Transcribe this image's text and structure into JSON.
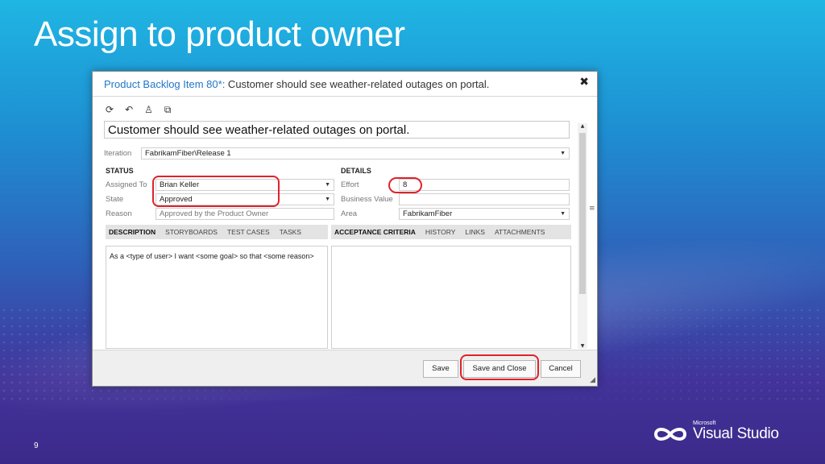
{
  "slide": {
    "title": "Assign to product owner",
    "page_number": "9",
    "logo": {
      "microsoft": "Microsoft",
      "product": "Visual Studio"
    }
  },
  "dialog": {
    "title_link": "Product Backlog Item 80*:",
    "title_text": " Customer should see weather-related outages on portal.",
    "close": "✖",
    "toolbar_icons": [
      "refresh-icon",
      "undo-icon",
      "assign-person-icon",
      "copy-icon"
    ],
    "title_value": "Customer should see weather-related outages on portal.",
    "iteration": {
      "label": "Iteration",
      "value": "FabrikamFiber\\Release 1"
    },
    "status": {
      "heading": "STATUS",
      "assigned_to": {
        "label": "Assigned To",
        "value": "Brian Keller"
      },
      "state": {
        "label": "State",
        "value": "Approved"
      },
      "reason": {
        "label": "Reason",
        "value": "Approved by the Product Owner"
      }
    },
    "details": {
      "heading": "DETAILS",
      "effort": {
        "label": "Effort",
        "value": "8"
      },
      "business_value": {
        "label": "Business Value",
        "value": ""
      },
      "area": {
        "label": "Area",
        "value": "FabrikamFiber"
      }
    },
    "left_tabs": [
      "DESCRIPTION",
      "STORYBOARDS",
      "TEST CASES",
      "TASKS"
    ],
    "right_tabs": [
      "ACCEPTANCE CRITERIA",
      "HISTORY",
      "LINKS",
      "ATTACHMENTS"
    ],
    "description": "As a <type of user> I want <some goal> so that <some reason>",
    "buttons": {
      "save": "Save",
      "save_close": "Save and Close",
      "cancel": "Cancel"
    }
  },
  "colors": {
    "highlight": "#e0222a",
    "link": "#1f76c8"
  }
}
